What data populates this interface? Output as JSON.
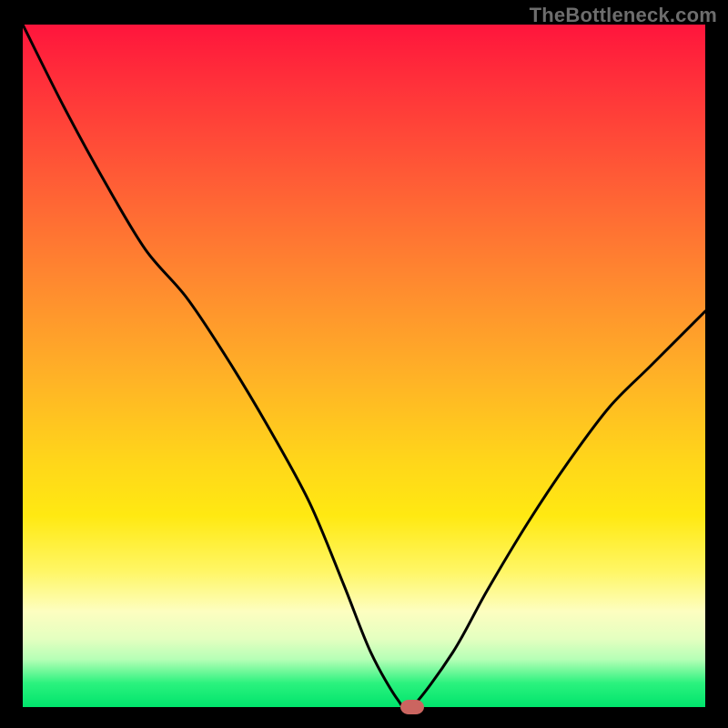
{
  "watermark": "TheBottleneck.com",
  "chart_data": {
    "type": "line",
    "title": "",
    "xlabel": "",
    "ylabel": "",
    "xlim": [
      0,
      100
    ],
    "ylim": [
      0,
      100
    ],
    "grid": false,
    "legend": false,
    "series": [
      {
        "name": "curve",
        "x": [
          0,
          6,
          12,
          18,
          24,
          30,
          36,
          42,
          47,
          51,
          55,
          57,
          63,
          68,
          74,
          80,
          86,
          92,
          100
        ],
        "values": [
          100,
          88,
          77,
          67,
          60,
          51,
          41,
          30,
          18,
          8,
          1,
          0,
          8,
          17,
          27,
          36,
          44,
          50,
          58
        ]
      }
    ],
    "marker": {
      "x": 57,
      "y": 0
    },
    "gradient_stops": [
      {
        "pos": 0,
        "color": "#ff153c"
      },
      {
        "pos": 8,
        "color": "#ff2f3a"
      },
      {
        "pos": 22,
        "color": "#ff5a36"
      },
      {
        "pos": 38,
        "color": "#ff8a2f"
      },
      {
        "pos": 52,
        "color": "#ffb326"
      },
      {
        "pos": 64,
        "color": "#ffd61a"
      },
      {
        "pos": 72,
        "color": "#ffe912"
      },
      {
        "pos": 80,
        "color": "#fff664"
      },
      {
        "pos": 86,
        "color": "#fdfec0"
      },
      {
        "pos": 90,
        "color": "#e4ffc0"
      },
      {
        "pos": 93,
        "color": "#b6ffb6"
      },
      {
        "pos": 96.5,
        "color": "#2bf27e"
      },
      {
        "pos": 100,
        "color": "#00e46c"
      }
    ]
  }
}
